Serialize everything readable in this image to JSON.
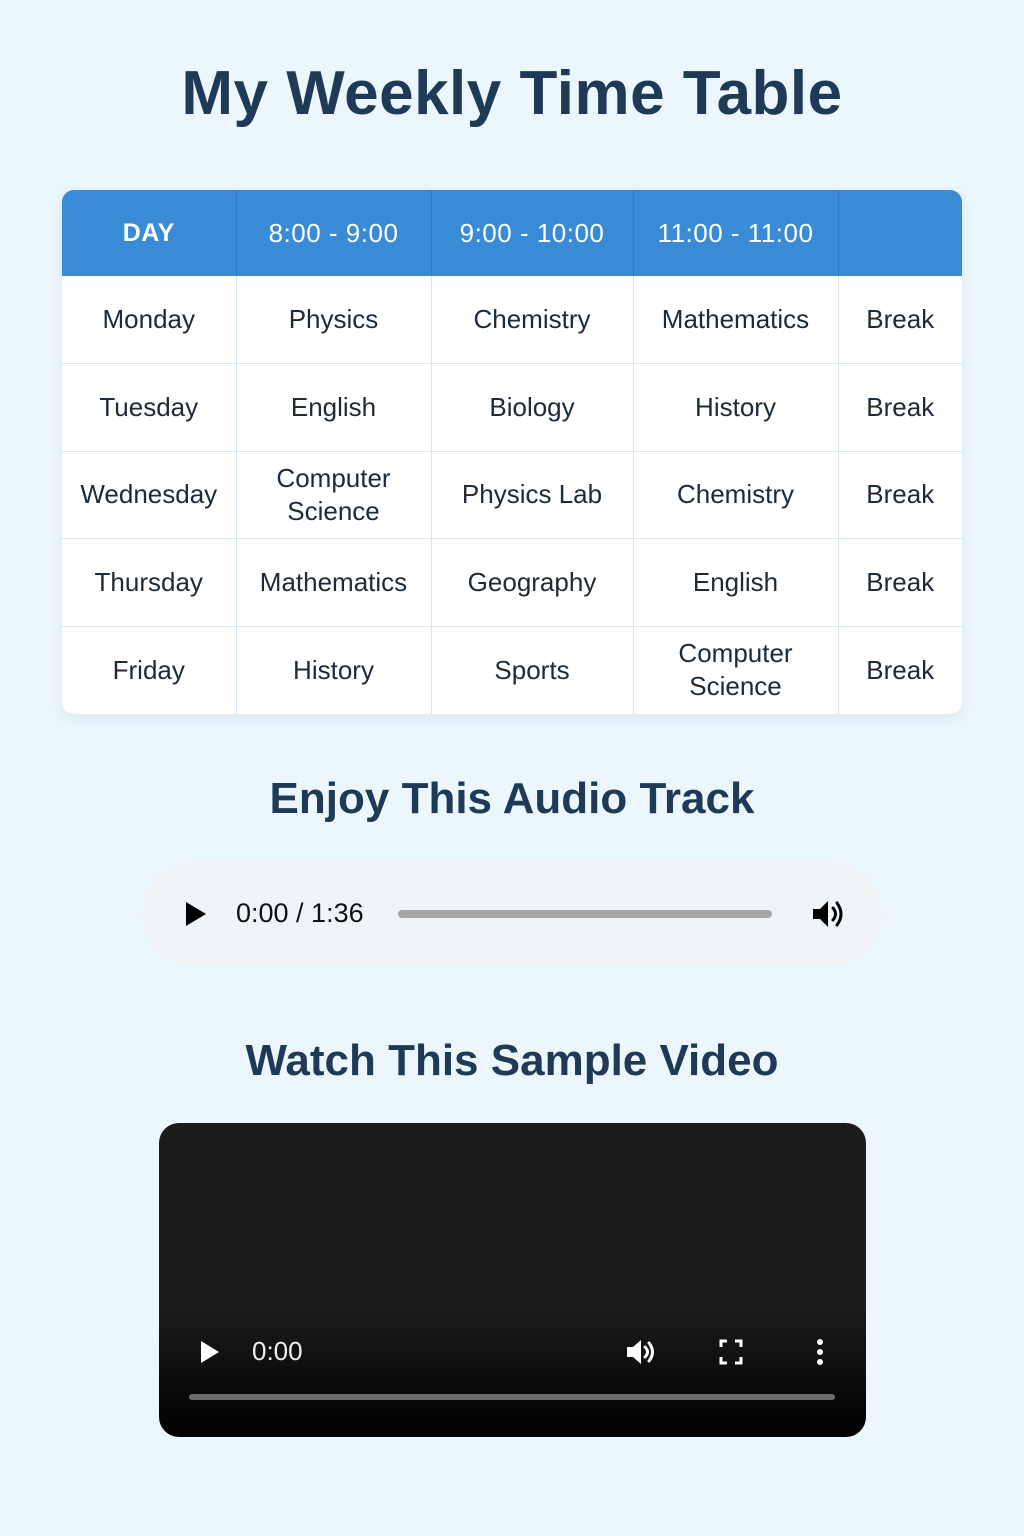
{
  "page": {
    "title": "My Weekly Time Table"
  },
  "timetable": {
    "headers": [
      "DAY",
      "8:00 - 9:00",
      "9:00 - 10:00",
      "11:00 - 11:00",
      ""
    ],
    "rows": [
      [
        "Monday",
        "Physics",
        "Chemistry",
        "Mathematics",
        "Break"
      ],
      [
        "Tuesday",
        "English",
        "Biology",
        "History",
        "Break"
      ],
      [
        "Wednesday",
        "Computer Science",
        "Physics Lab",
        "Chemistry",
        "Break"
      ],
      [
        "Thursday",
        "Mathematics",
        "Geography",
        "English",
        "Break"
      ],
      [
        "Friday",
        "History",
        "Sports",
        "Computer Science",
        "Break"
      ]
    ],
    "header_color": "#3a8bd6"
  },
  "audio": {
    "section_title": "Enjoy This Audio Track",
    "time": "0:00 / 1:36",
    "progress": 0,
    "icons": {
      "play": "play-icon",
      "volume": "volume-icon"
    }
  },
  "video": {
    "section_title": "Watch This Sample Video",
    "time": "0:00",
    "progress": 0,
    "icons": {
      "play": "play-icon",
      "volume": "volume-icon",
      "fullscreen": "fullscreen-icon",
      "more": "more-options-icon"
    }
  },
  "colors": {
    "background": "#ecf6fd",
    "heading": "#1f3a56"
  }
}
